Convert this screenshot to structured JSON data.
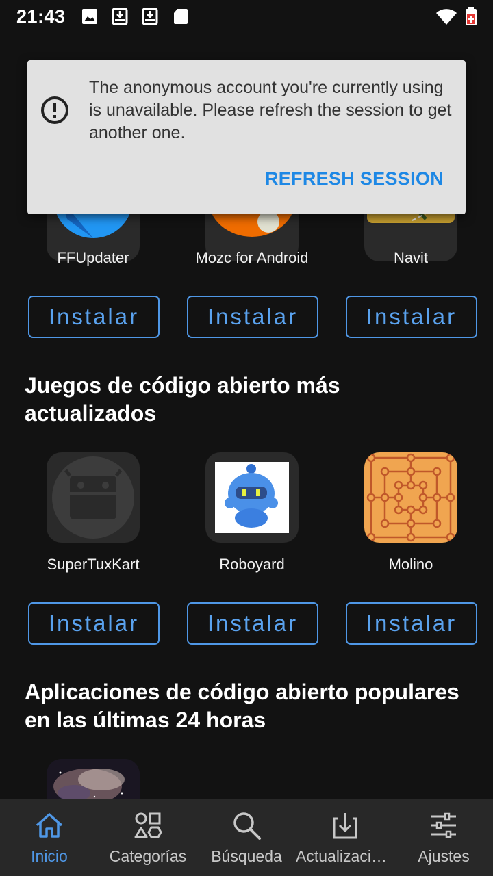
{
  "status_bar": {
    "time": "21:43"
  },
  "dialog": {
    "message": "The anonymous account you're currently using is unavailable. Please refresh the session to get another one.",
    "action": "REFRESH SESSION"
  },
  "section1": {
    "apps": [
      {
        "name": "FFUpdater",
        "install": "Instalar"
      },
      {
        "name": "Mozc for Android",
        "install": "Instalar"
      },
      {
        "name": "Navit",
        "install": "Instalar"
      }
    ]
  },
  "section2": {
    "title": "Juegos de código abierto más actualizados",
    "apps": [
      {
        "name": "SuperTuxKart",
        "install": "Instalar"
      },
      {
        "name": "Roboyard",
        "install": "Instalar"
      },
      {
        "name": "Molino",
        "install": "Instalar"
      }
    ]
  },
  "section3": {
    "title": "Aplicaciones de código abierto populares en las últimas 24 horas"
  },
  "bottom_nav": {
    "items": [
      {
        "label": "Inicio",
        "icon": "home-icon",
        "active": true
      },
      {
        "label": "Categorías",
        "icon": "categories-icon"
      },
      {
        "label": "Búsqueda",
        "icon": "search-icon"
      },
      {
        "label": "Actualizaciones",
        "icon": "download-icon"
      },
      {
        "label": "Ajustes",
        "icon": "settings-sliders-icon"
      }
    ]
  },
  "colors": {
    "accent": "#4f97e6",
    "background": "#121212",
    "dialog": "#e1e1e1",
    "dialog_action": "#1e88e5"
  }
}
